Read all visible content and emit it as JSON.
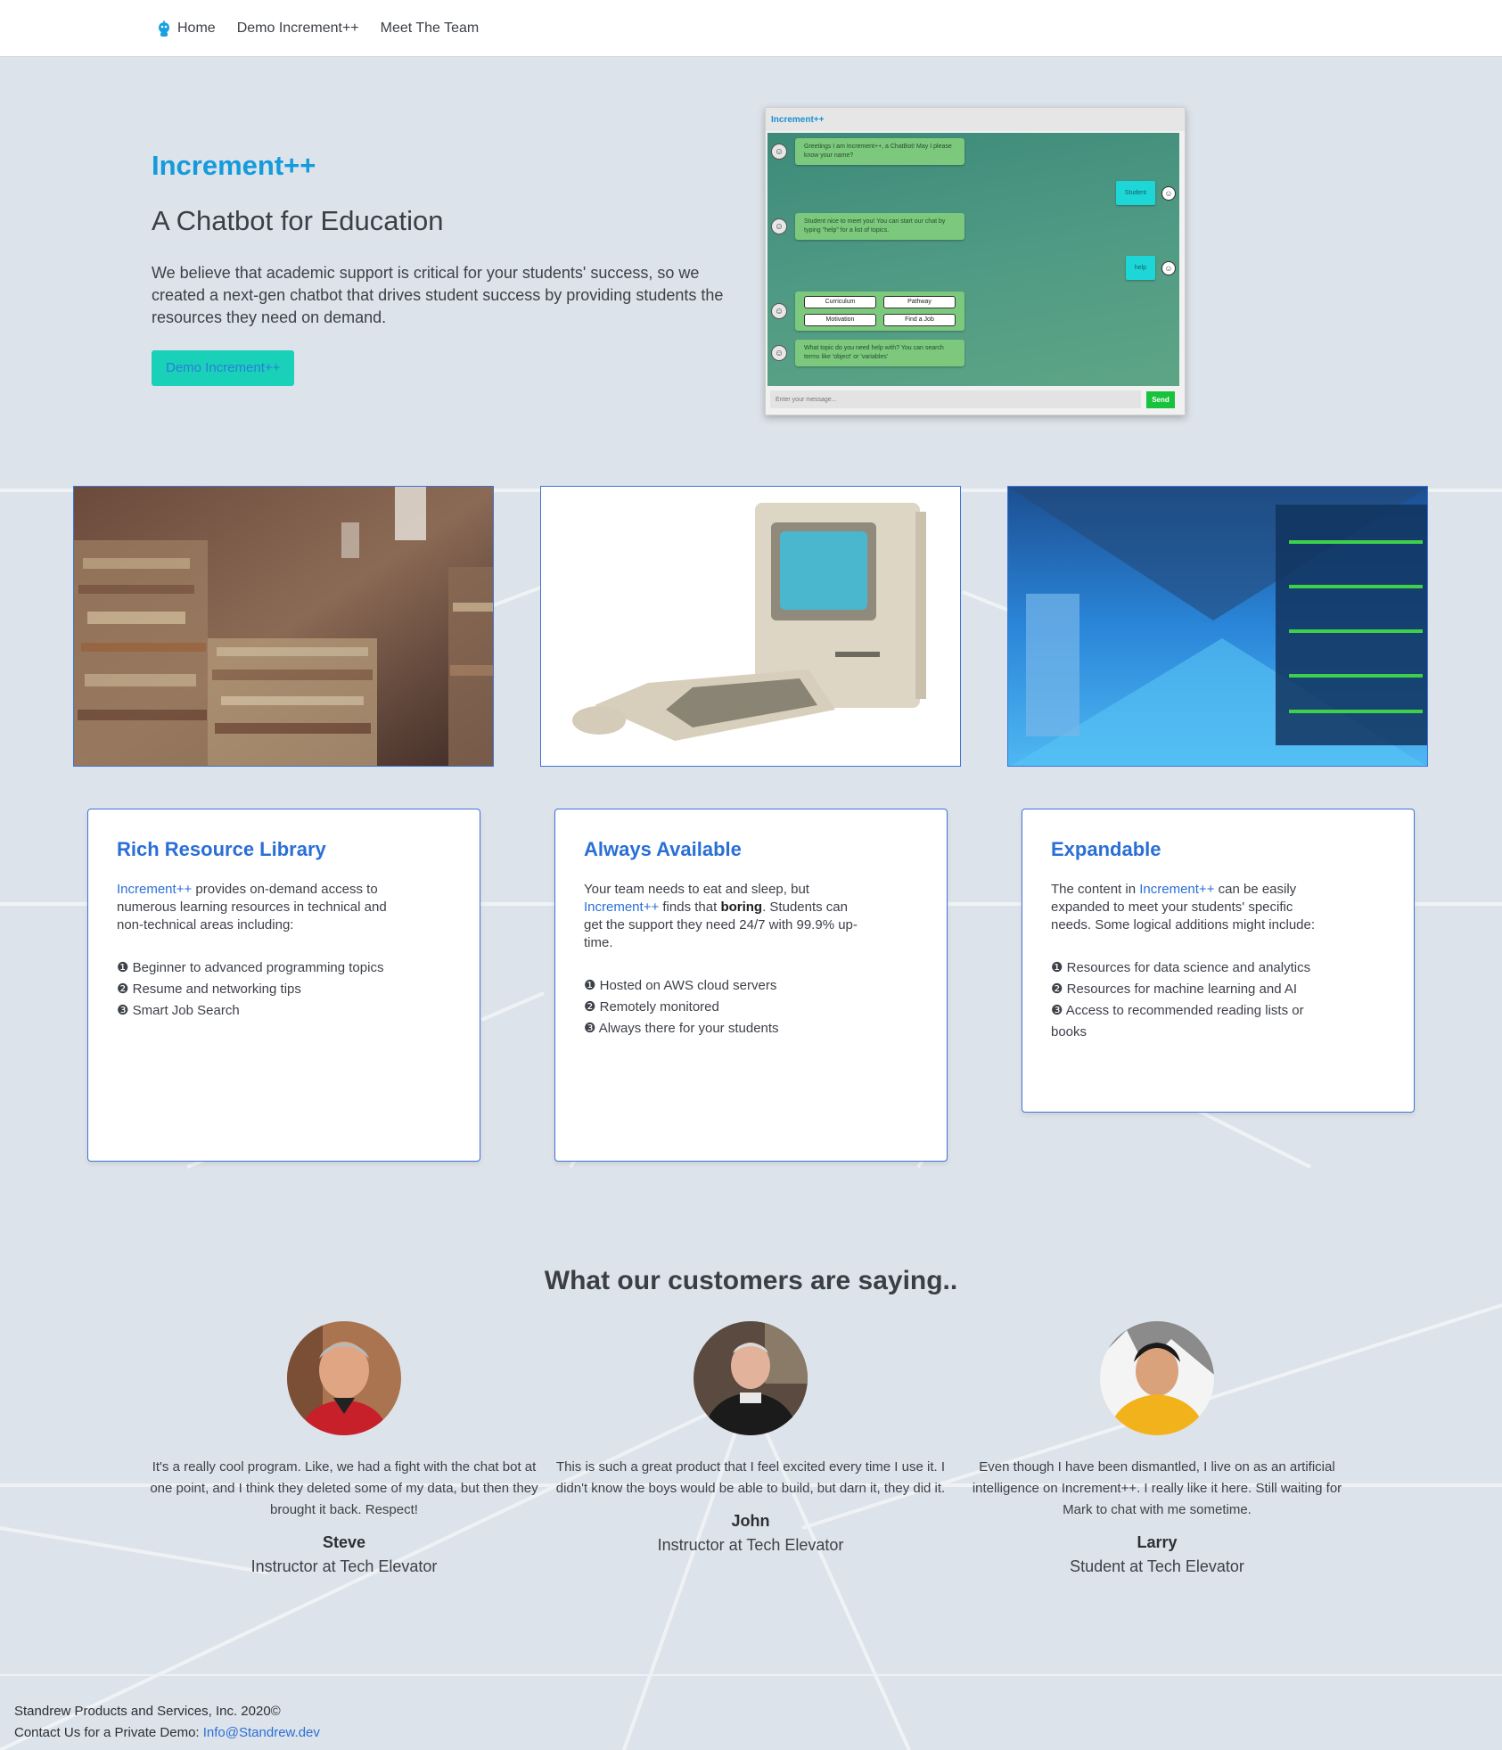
{
  "nav": {
    "home_label": "Home",
    "demo_label": "Demo Increment++",
    "team_label": "Meet The Team"
  },
  "hero": {
    "brand": "Increment++",
    "title": "A Chatbot for Education",
    "description": "We believe that academic support is critical for your students' success, so we created a next-gen chatbot that drives student success by providing students the resources they need on demand.",
    "button_label": "Demo Increment++"
  },
  "chat_preview": {
    "header": "Increment++",
    "bot_greeting": "Greetings I am Increment++, a ChatBot! May I please know your name?",
    "user_reply_1": "Student",
    "bot_reply": "Student nice to meet you! You can start our chat by typing \"help\" for a list of topics.",
    "user_reply_2": "help",
    "topics": [
      "Curriculum",
      "Pathway",
      "Motivation",
      "Find a Job"
    ],
    "bot_question": "What topic do you need help with? You can search terms like 'object' or 'variables'",
    "input_placeholder": "Enter your message...",
    "send_label": "Send"
  },
  "photos": [
    {
      "name": "bookshelf-photo"
    },
    {
      "name": "vintage-computer-photo"
    },
    {
      "name": "data-center-photo"
    }
  ],
  "cards": [
    {
      "title": "Rich Resource Library",
      "link_text": "Increment++",
      "text": " provides on-demand access to numerous learning resources in technical and non-technical areas including:",
      "items": [
        "❶ Beginner to advanced programming topics",
        "❷ Resume and networking tips",
        "❸ Smart Job Search"
      ]
    },
    {
      "title": "Always Available",
      "text_before": "Your team needs to eat and sleep, but ",
      "link_text": "Increment++",
      "text_middle": " finds that ",
      "bold_text": "boring",
      "text_after": ". Students can get the support they need 24/7 with 99.9% up-time.",
      "items": [
        "❶ Hosted on AWS cloud servers",
        "❷ Remotely monitored",
        "❸ Always there for your students"
      ]
    },
    {
      "title": "Expandable",
      "text_before": "The content in ",
      "link_text": "Increment++",
      "text_after": " can be easily expanded to meet your students' specific needs. Some logical additions might include:",
      "items": [
        "❶ Resources for data science and analytics",
        "❷ Resources for machine learning and AI",
        "❸ Access to recommended reading lists or books"
      ]
    }
  ],
  "testimonials": {
    "title": "What our customers are saying..",
    "items": [
      {
        "quote": "It's a really cool program. Like, we had a fight with the chat bot at one point, and I think they deleted some of my data, but then they brought it back. Respect!",
        "name": "Steve",
        "role": "Instructor at Tech Elevator"
      },
      {
        "quote": "This is such a great product that I feel excited every time I use it. I didn't know the boys would be able to build, but darn it, they did it.",
        "name": "John",
        "role": "Instructor at Tech Elevator"
      },
      {
        "quote": "Even though I have been dismantled, I live on as an artificial intelligence on Increment++. I really like it here. Still waiting for Mark to chat with me sometime.",
        "name": "Larry",
        "role": "Student at Tech Elevator"
      }
    ]
  },
  "footer": {
    "company": "Standrew Products and Services, Inc. 2020©",
    "contact_prefix": "Contact Us for a Private Demo: ",
    "email": "Info@Standrew.dev"
  },
  "colors": {
    "accent": "#159bdb",
    "link": "#2a6fd6",
    "button": "#19d1b8",
    "background": "#dde3ea"
  }
}
